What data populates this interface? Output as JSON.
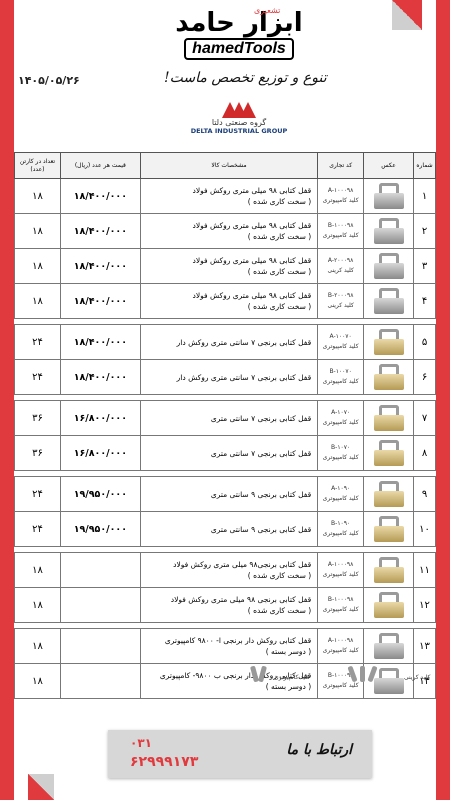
{
  "header": {
    "logo_fa_main": "ابزار حامد",
    "logo_fa_sub": "تشعیری",
    "logo_en": "hamedTools",
    "logo_en_small": "ICO",
    "date": "۱۴۰۵/۰۵/۲۶",
    "slogan": "تنوع و توزیع تخصص ماست!"
  },
  "brand": {
    "name_fa": "گروه صنعتی دلتا",
    "name_en": "DELTA INDUSTRIAL GROUP"
  },
  "table": {
    "headers": {
      "row": "شماره",
      "image": "عکس",
      "code": "کد تجاری",
      "spec": "مشخصات کالا",
      "price": "قیمت هر عدد (ریال)",
      "qty": "تعداد در کارتن (عدد)"
    },
    "groups": [
      {
        "rows": [
          {
            "n": "۱",
            "code": "A-۱۰۰۰۹۸",
            "code_sub": "کلید کامپیوتری",
            "img": "s",
            "desc1": "قفل کتابی ۹۸ میلی متری روکش فولاد",
            "desc2": "( سخت کاری شده )",
            "price": "۱۸/۴۰۰/۰۰۰",
            "qty": "۱۸"
          },
          {
            "n": "۲",
            "code": "B-۱۰۰۰۹۸",
            "code_sub": "کلید کامپیوتری",
            "img": "s",
            "desc1": "قفل کتابی ۹۸ میلی متری روکش فولاد",
            "desc2": "( سخت کاری شده )",
            "price": "۱۸/۴۰۰/۰۰۰",
            "qty": "۱۸"
          },
          {
            "n": "۳",
            "code": "A-۲۰۰۰۹۸",
            "code_sub": "کلید کرینی",
            "img": "s",
            "desc1": "قفل کتابی ۹۸ میلی متری روکش فولاد",
            "desc2": "( سخت کاری شده )",
            "price": "۱۸/۴۰۰/۰۰۰",
            "qty": "۱۸"
          },
          {
            "n": "۴",
            "code": "B-۲۰۰۰۹۸",
            "code_sub": "کلید کرینی",
            "img": "s",
            "desc1": "قفل کتابی ۹۸ میلی متری روکش فولاد",
            "desc2": "( سخت کاری شده )",
            "price": "۱۸/۴۰۰/۰۰۰",
            "qty": "۱۸"
          }
        ]
      },
      {
        "rows": [
          {
            "n": "۵",
            "code": "A-۱۰۰۷۰",
            "code_sub": "کلید کامپیوتری",
            "img": "b",
            "desc1": "قفل کتابی برنجی ۷ سانتی متری روکش دار",
            "desc2": "",
            "price": "۱۸/۴۰۰/۰۰۰",
            "qty": "۲۴"
          },
          {
            "n": "۶",
            "code": "B-۱۰۰۷۰",
            "code_sub": "کلید کامپیوتری",
            "img": "b",
            "desc1": "قفل کتابی برنجی ۷ سانتی متری روکش دار",
            "desc2": "",
            "price": "۱۸/۴۰۰/۰۰۰",
            "qty": "۲۴"
          }
        ]
      },
      {
        "rows": [
          {
            "n": "۷",
            "code": "A-۱۰۷۰",
            "code_sub": "کلید کامپیوتری",
            "img": "b",
            "desc1": "قفل کتابی برنجی ۷ سانتی متری",
            "desc2": "",
            "price": "۱۶/۸۰۰/۰۰۰",
            "qty": "۳۶"
          },
          {
            "n": "۸",
            "code": "B-۱۰۷۰",
            "code_sub": "کلید کامپیوتری",
            "img": "b",
            "desc1": "قفل کتابی برنجی ۷ سانتی متری",
            "desc2": "",
            "price": "۱۶/۸۰۰/۰۰۰",
            "qty": "۳۶"
          }
        ]
      },
      {
        "rows": [
          {
            "n": "۹",
            "code": "A-۱۰۹۰",
            "code_sub": "کلید کامپیوتری",
            "img": "b",
            "desc1": "قفل کتابی برنجی ۹ سانتی متری",
            "desc2": "",
            "price": "۱۹/۹۵۰/۰۰۰",
            "qty": "۲۴"
          },
          {
            "n": "۱۰",
            "code": "B-۱۰۹۰",
            "code_sub": "کلید کامپیوتری",
            "img": "b",
            "desc1": "قفل کتابی برنجی ۹ سانتی متری",
            "desc2": "",
            "price": "۱۹/۹۵۰/۰۰۰",
            "qty": "۲۴"
          }
        ]
      },
      {
        "rows": [
          {
            "n": "۱۱",
            "code": "A-۱۰۰۰۹۸",
            "code_sub": "کلید کامپیوتری",
            "img": "b",
            "desc1": "قفل کتابی برنجی۹۸ میلی متری روکش فولاد",
            "desc2": "( سخت کاری شده )",
            "price": "",
            "qty": "۱۸"
          },
          {
            "n": "۱۲",
            "code": "B-۱۰۰۰۹۸",
            "code_sub": "کلید کامپیوتری",
            "img": "b",
            "desc1": "قفل کتابی برنجی ۹۸ میلی متری روکش فولاد",
            "desc2": "( سخت کاری شده )",
            "price": "",
            "qty": "۱۸"
          }
        ]
      },
      {
        "rows": [
          {
            "n": "۱۳",
            "code": "A-۱۰۰۰۹۸",
            "code_sub": "کلید کامپیوتری",
            "img": "s",
            "desc1": "قفل کتابی روکش دار برنجی ا- ۹۸۰۰ کامپیوتری",
            "desc2": "( دوسر بسته )",
            "price": "",
            "qty": "۱۸"
          },
          {
            "n": "۱۴",
            "code": "B-۱۰۰۰۹۸",
            "code_sub": "کلید کامپیوتری",
            "img": "s",
            "desc1": "قفل کتابی روکش دار برنجی ب ۹۸۰۰- کامپیوتری",
            "desc2": "( دوسر بسته )",
            "price": "",
            "qty": "۱۸"
          }
        ]
      }
    ]
  },
  "keys": {
    "label_right": "کلید کرینی",
    "label_left": "کلید کامپیوتری"
  },
  "footer": {
    "contact_label": "ارتباط با ما",
    "phone_code": "۰۳۱",
    "phone_number": "۶۲۹۹۹۱۷۳"
  }
}
